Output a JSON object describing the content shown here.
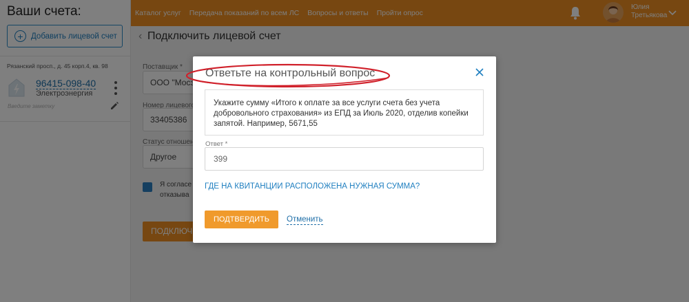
{
  "sidebar": {
    "title": "Ваши счета:",
    "add_button": "Добавить лицевой счет",
    "account": {
      "address": "Рязанский просп., д. 45 корп.4, кв. 98",
      "number": "96415-098-40",
      "service": "Электроэнергия",
      "note_placeholder": "Введите заметку"
    }
  },
  "topbar": {
    "nav": [
      "Каталог услуг",
      "Передача показаний по всем ЛС",
      "Вопросы и ответы",
      "Пройти опрос"
    ],
    "user": {
      "first_name": "Юлия",
      "last_name": "Третьякова"
    }
  },
  "main": {
    "title": "Подключить лицевой счет",
    "supplier_label": "Поставщик *",
    "supplier_value": "ООО \"Мосэ",
    "account_label": "Номер лицевого",
    "account_value": "33405386",
    "status_label": "Статус отношен",
    "status_value": "Другое",
    "consent_line1": "Я согласе",
    "consent_line2": "отказыва",
    "submit_label": "ПОДКЛЮЧИ"
  },
  "modal": {
    "title": "Ответьте на контрольный вопрос",
    "question": "Укажите сумму «Итого к оплате за все услуги счета без учета добровольного страхования» из ЕПД за Июль 2020, отделив копейки запятой. Например, 5671,55",
    "answer_label": "Ответ *",
    "answer_value": "399",
    "help_link": "ГДЕ НА КВИТАНЦИИ РАСПОЛОЖЕНА НУЖНАЯ СУММА?",
    "confirm_label": "ПОДТВЕРДИТЬ",
    "cancel_label": "Отменить"
  },
  "colors": {
    "accent_orange": "#ef8f22",
    "link_blue": "#1f7fc0",
    "annotation_red": "#d0202a"
  }
}
